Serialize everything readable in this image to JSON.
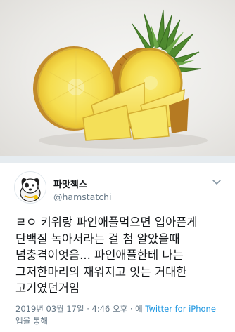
{
  "tweet": {
    "display_name": "파맛첵스",
    "handle": "@hamstatchi",
    "text_lines": [
      "ㄹㅇ 키위랑 파인애플먹으면 입아픈게",
      "단백질 녹아서라는 걸 첨 알았을때",
      "넘충격이엇음... 파인애플한테 나는",
      "그저한마리의 재워지고 잇는 거대한",
      "고기였던거임"
    ],
    "timestamp": "2019년 03월 17일 · 4:46 오후 · 에",
    "source_link": "Twitter for iPhone",
    "source_suffix": "앱을 통해"
  },
  "icons": {
    "menu": "chevron-down-icon",
    "avatar": "dog-avatar"
  },
  "colors": {
    "link": "#1b95e0",
    "secondary_text": "#657786",
    "divider": "#e6ecf0"
  }
}
